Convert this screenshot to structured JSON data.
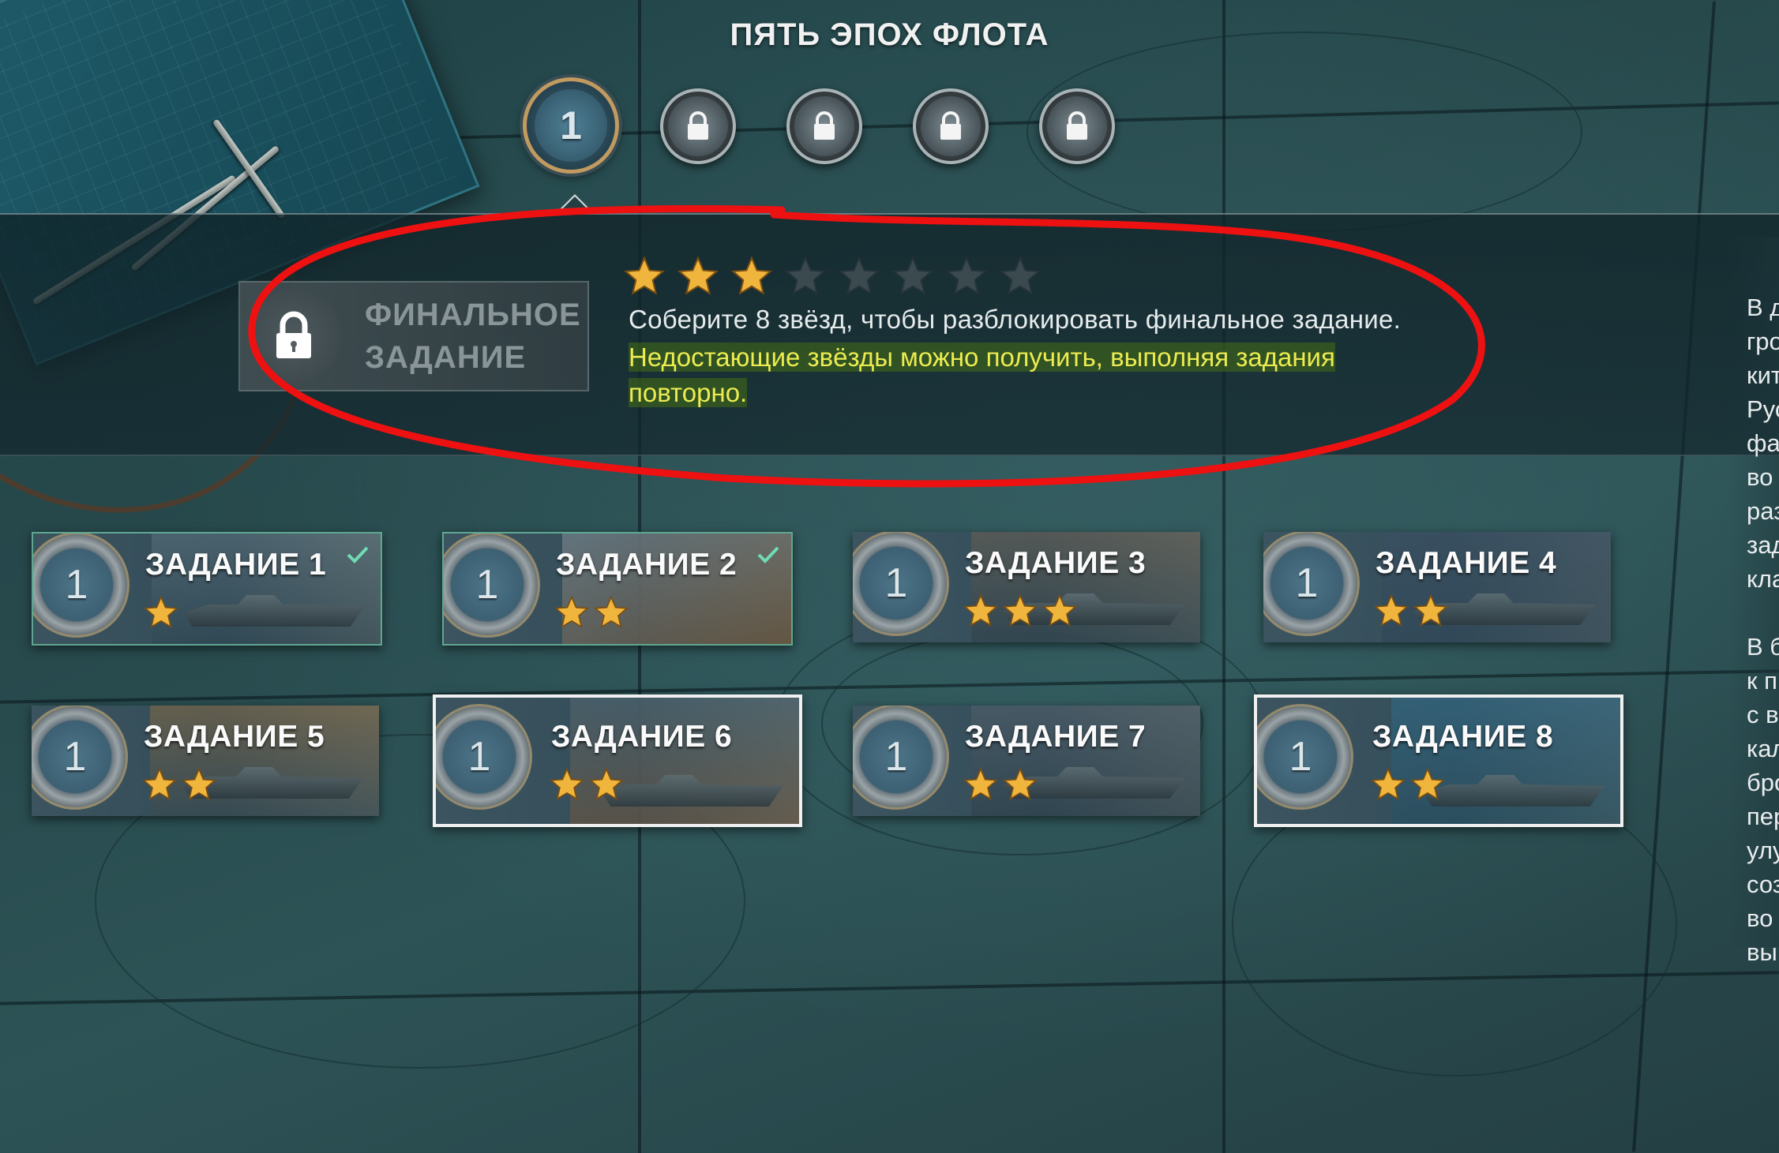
{
  "header": {
    "title": "ПЯТЬ ЭПОХ ФЛОТА"
  },
  "eras": [
    {
      "label": "1",
      "state": "active",
      "icon": "era-medal-1"
    },
    {
      "label": "",
      "state": "locked",
      "icon": "lock-icon"
    },
    {
      "label": "",
      "state": "locked",
      "icon": "lock-icon"
    },
    {
      "label": "",
      "state": "locked",
      "icon": "lock-icon"
    },
    {
      "label": "",
      "state": "locked",
      "icon": "lock-icon"
    }
  ],
  "final_task": {
    "title_line1": "ФИНАЛЬНОЕ",
    "title_line2": "ЗАДАНИЕ",
    "stars_earned": 3,
    "stars_total": 8,
    "description": "Соберите 8 звёзд, чтобы разблокировать финальное задание.",
    "hint": "Недостающие звёзды можно получить, выполняя задания повторно.",
    "hint_color": "#ecec50"
  },
  "tasks": [
    {
      "medal": "1",
      "label": "ЗАДАНИЕ 1",
      "stars": 1,
      "completed": true,
      "selected": false
    },
    {
      "medal": "1",
      "label": "ЗАДАНИЕ 2",
      "stars": 2,
      "completed": true,
      "selected": false
    },
    {
      "medal": "1",
      "label": "ЗАДАНИЕ 3",
      "stars": 3,
      "completed": false,
      "selected": false
    },
    {
      "medal": "1",
      "label": "ЗАДАНИЕ 4",
      "stars": 2,
      "completed": false,
      "selected": false
    },
    {
      "medal": "1",
      "label": "ЗАДАНИЕ 5",
      "stars": 2,
      "completed": false,
      "selected": false
    },
    {
      "medal": "1",
      "label": "ЗАДАНИЕ 6",
      "stars": 2,
      "completed": false,
      "selected": true
    },
    {
      "medal": "1",
      "label": "ЗАДАНИЕ 7",
      "stars": 2,
      "completed": false,
      "selected": false
    },
    {
      "medal": "1",
      "label": "ЗАДАНИЕ 8",
      "stars": 2,
      "completed": false,
      "selected": true
    }
  ],
  "side_text": {
    "paragraph1": [
      "В д",
      "гро",
      "кит",
      "Рус",
      "фа",
      "во",
      "раз",
      "зад",
      "кла"
    ],
    "paragraph2": [
      "В б",
      "к п",
      "с в",
      "кал",
      "бро",
      "пер",
      "улу",
      "соз",
      "во",
      "вы"
    ]
  },
  "colors": {
    "star_gold": "#f0b53c",
    "star_empty": "#3a4a4f",
    "completed_border": "#5ea791",
    "check": "#6fdcb5",
    "annotation_red": "#ee1111"
  }
}
